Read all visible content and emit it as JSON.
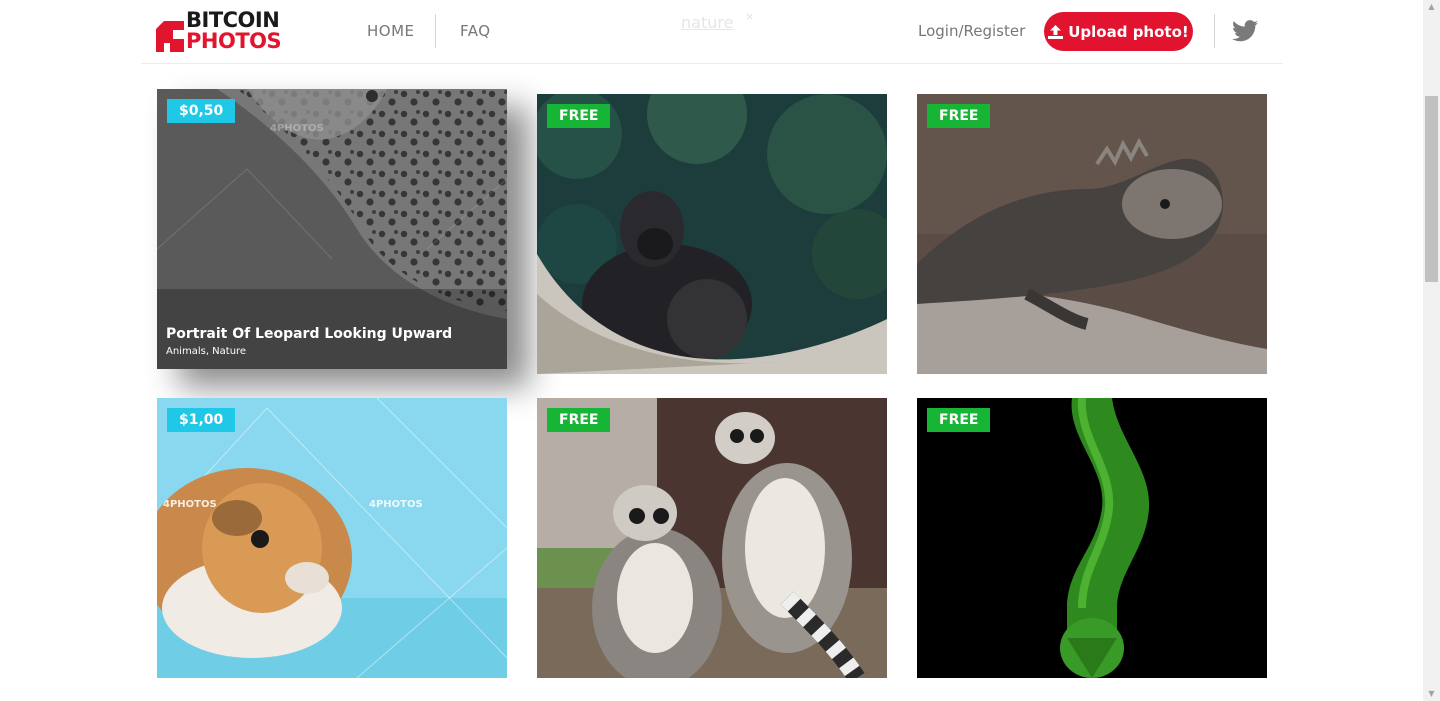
{
  "header": {
    "logo": {
      "word1": "BITCOIN",
      "word2": "PHOTOS"
    },
    "nav": {
      "home": "HOME",
      "faq": "FAQ"
    },
    "search_tag": "nature",
    "search_tag_remove": "×",
    "login": "Login/Register",
    "upload": "Upload photo!",
    "twitter_icon": "twitter-icon"
  },
  "photos": [
    {
      "badge": "$0,50",
      "badge_type": "paid",
      "title": "Portrait Of Leopard Looking Upward",
      "tags": "Animals, Nature",
      "watermark": "4PHOTOS",
      "subject": "leopard"
    },
    {
      "badge": "FREE",
      "badge_type": "free",
      "subject": "gorilla"
    },
    {
      "badge": "FREE",
      "badge_type": "free",
      "subject": "iguana"
    },
    {
      "badge": "$1,00",
      "badge_type": "paid",
      "watermark": "4PHOTOS",
      "subject": "guinea pig"
    },
    {
      "badge": "FREE",
      "badge_type": "free",
      "subject": "lemurs"
    },
    {
      "badge": "FREE",
      "badge_type": "free",
      "subject": "green snake"
    }
  ],
  "colors": {
    "brand_red": "#e2132f",
    "free_badge": "#16b535",
    "paid_badge": "#1ec8e6"
  }
}
